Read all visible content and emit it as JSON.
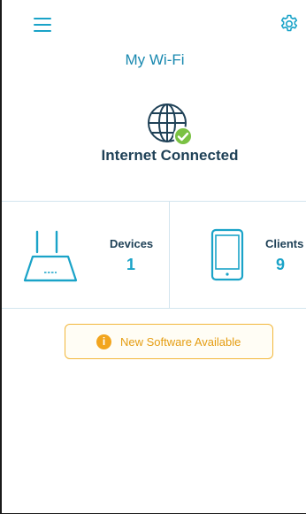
{
  "header": {
    "menu_icon": "hamburger-menu-icon",
    "settings_icon": "gear-icon",
    "title": "My Wi-Fi"
  },
  "status": {
    "icon": "globe-icon",
    "badge_icon": "check-icon",
    "text": "Internet Connected"
  },
  "stats": {
    "devices": {
      "label": "Devices",
      "value": "1",
      "icon": "router-icon"
    },
    "clients": {
      "label": "Clients",
      "value": "9",
      "icon": "phone-icon"
    }
  },
  "notice": {
    "icon": "info-icon",
    "icon_glyph": "i",
    "label": "New Software Available"
  },
  "colors": {
    "accent": "#1aa3c8",
    "title": "#1a89b0",
    "dark_text": "#1f4157",
    "success": "#7ac143",
    "warning": "#f2a51e",
    "warning_text": "#e59d12",
    "divider": "#d3e5ee"
  }
}
